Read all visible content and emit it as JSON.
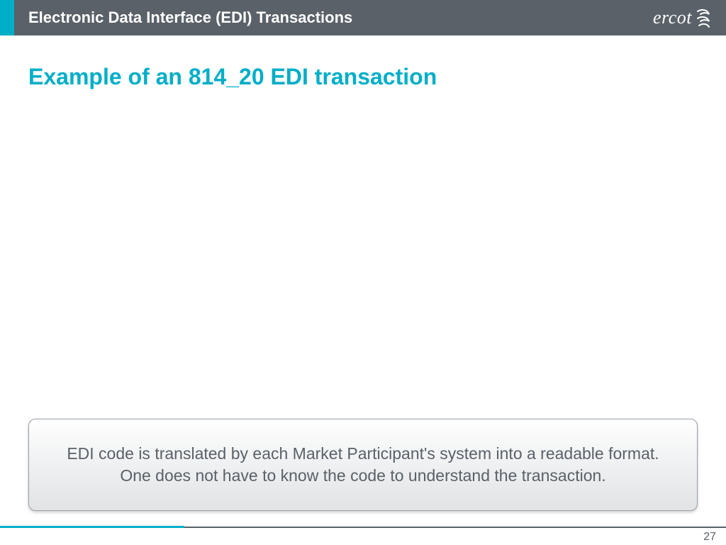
{
  "header": {
    "title": "Electronic Data Interface (EDI) Transactions",
    "logo_text": "ercot"
  },
  "slide": {
    "title": "Example of an 814_20 EDI transaction"
  },
  "callout": {
    "line1": "EDI code is translated by each Market Participant's system into a readable format.",
    "line2": "One does not have to know the code to understand the transaction."
  },
  "page_number": "27",
  "colors": {
    "accent": "#00aec7",
    "header_bg": "#5a6168",
    "body_text": "#5a6168"
  }
}
